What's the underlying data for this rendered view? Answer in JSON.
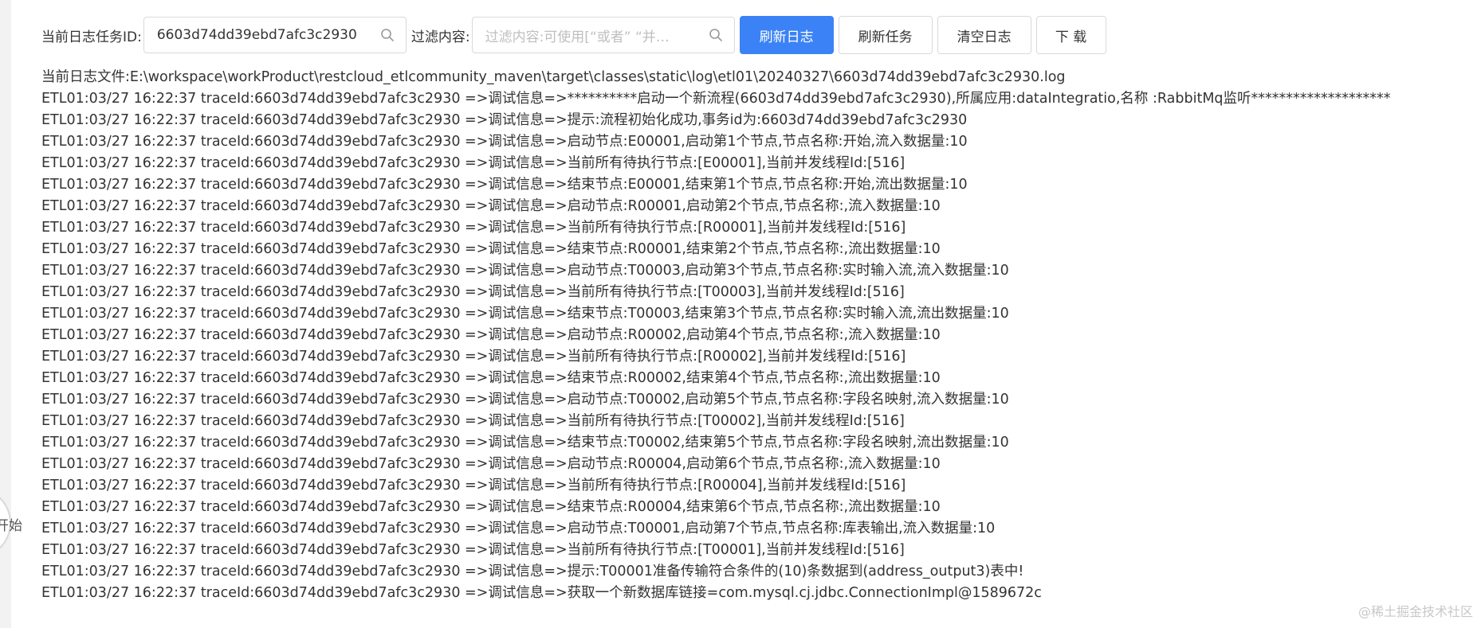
{
  "toolbar": {
    "task_id_label": "当前日志任务ID:",
    "task_id_value": "6603d74dd39ebd7afc3c2930",
    "filter_label": "过滤内容:",
    "filter_placeholder": "过滤内容:可使用[“或者” “并…",
    "refresh_log_label": "刷新日志",
    "refresh_task_label": "刷新任务",
    "clear_log_label": "清空日志",
    "download_label": "下 载",
    "primary_color": "#3b82f6"
  },
  "log": {
    "file_line": "当前日志文件:E:\\workspace\\workProduct\\restcloud_etlcommunity_maven\\target\\classes\\static\\log\\etl01\\20240327\\6603d74dd39ebd7afc3c2930.log",
    "lines": [
      "ETL01:03/27 16:22:37 traceId:6603d74dd39ebd7afc3c2930 =>调试信息=>**********启动一个新流程(6603d74dd39ebd7afc3c2930),所属应用:dataIntegratio,名称 :RabbitMq监听********************",
      "ETL01:03/27 16:22:37 traceId:6603d74dd39ebd7afc3c2930 =>调试信息=>提示:流程初始化成功,事务id为:6603d74dd39ebd7afc3c2930",
      "ETL01:03/27 16:22:37 traceId:6603d74dd39ebd7afc3c2930 =>调试信息=>启动节点:E00001,启动第1个节点,节点名称:开始,流入数据量:10",
      "ETL01:03/27 16:22:37 traceId:6603d74dd39ebd7afc3c2930 =>调试信息=>当前所有待执行节点:[E00001],当前并发线程Id:[516]",
      "ETL01:03/27 16:22:37 traceId:6603d74dd39ebd7afc3c2930 =>调试信息=>结束节点:E00001,结束第1个节点,节点名称:开始,流出数据量:10",
      "ETL01:03/27 16:22:37 traceId:6603d74dd39ebd7afc3c2930 =>调试信息=>启动节点:R00001,启动第2个节点,节点名称:,流入数据量:10",
      "ETL01:03/27 16:22:37 traceId:6603d74dd39ebd7afc3c2930 =>调试信息=>当前所有待执行节点:[R00001],当前并发线程Id:[516]",
      "ETL01:03/27 16:22:37 traceId:6603d74dd39ebd7afc3c2930 =>调试信息=>结束节点:R00001,结束第2个节点,节点名称:,流出数据量:10",
      "ETL01:03/27 16:22:37 traceId:6603d74dd39ebd7afc3c2930 =>调试信息=>启动节点:T00003,启动第3个节点,节点名称:实时输入流,流入数据量:10",
      "ETL01:03/27 16:22:37 traceId:6603d74dd39ebd7afc3c2930 =>调试信息=>当前所有待执行节点:[T00003],当前并发线程Id:[516]",
      "ETL01:03/27 16:22:37 traceId:6603d74dd39ebd7afc3c2930 =>调试信息=>结束节点:T00003,结束第3个节点,节点名称:实时输入流,流出数据量:10",
      "ETL01:03/27 16:22:37 traceId:6603d74dd39ebd7afc3c2930 =>调试信息=>启动节点:R00002,启动第4个节点,节点名称:,流入数据量:10",
      "ETL01:03/27 16:22:37 traceId:6603d74dd39ebd7afc3c2930 =>调试信息=>当前所有待执行节点:[R00002],当前并发线程Id:[516]",
      "ETL01:03/27 16:22:37 traceId:6603d74dd39ebd7afc3c2930 =>调试信息=>结束节点:R00002,结束第4个节点,节点名称:,流出数据量:10",
      "ETL01:03/27 16:22:37 traceId:6603d74dd39ebd7afc3c2930 =>调试信息=>启动节点:T00002,启动第5个节点,节点名称:字段名映射,流入数据量:10",
      "ETL01:03/27 16:22:37 traceId:6603d74dd39ebd7afc3c2930 =>调试信息=>当前所有待执行节点:[T00002],当前并发线程Id:[516]",
      "ETL01:03/27 16:22:37 traceId:6603d74dd39ebd7afc3c2930 =>调试信息=>结束节点:T00002,结束第5个节点,节点名称:字段名映射,流出数据量:10",
      "ETL01:03/27 16:22:37 traceId:6603d74dd39ebd7afc3c2930 =>调试信息=>启动节点:R00004,启动第6个节点,节点名称:,流入数据量:10",
      "ETL01:03/27 16:22:37 traceId:6603d74dd39ebd7afc3c2930 =>调试信息=>当前所有待执行节点:[R00004],当前并发线程Id:[516]",
      "ETL01:03/27 16:22:37 traceId:6603d74dd39ebd7afc3c2930 =>调试信息=>结束节点:R00004,结束第6个节点,节点名称:,流出数据量:10",
      "ETL01:03/27 16:22:37 traceId:6603d74dd39ebd7afc3c2930 =>调试信息=>启动节点:T00001,启动第7个节点,节点名称:库表输出,流入数据量:10",
      "ETL01:03/27 16:22:37 traceId:6603d74dd39ebd7afc3c2930 =>调试信息=>当前所有待执行节点:[T00001],当前并发线程Id:[516]",
      "ETL01:03/27 16:22:37 traceId:6603d74dd39ebd7afc3c2930 =>调试信息=>提示:T00001准备传输符合条件的(10)条数据到(address_output3)表中!",
      "ETL01:03/27 16:22:37 traceId:6603d74dd39ebd7afc3c2930 =>调试信息=>获取一个新数据库链接=com.mysql.cj.jdbc.ConnectionImpl@1589672c"
    ]
  },
  "side_panel": {
    "partial_text": "开始"
  },
  "watermark": "@稀土掘金技术社区"
}
